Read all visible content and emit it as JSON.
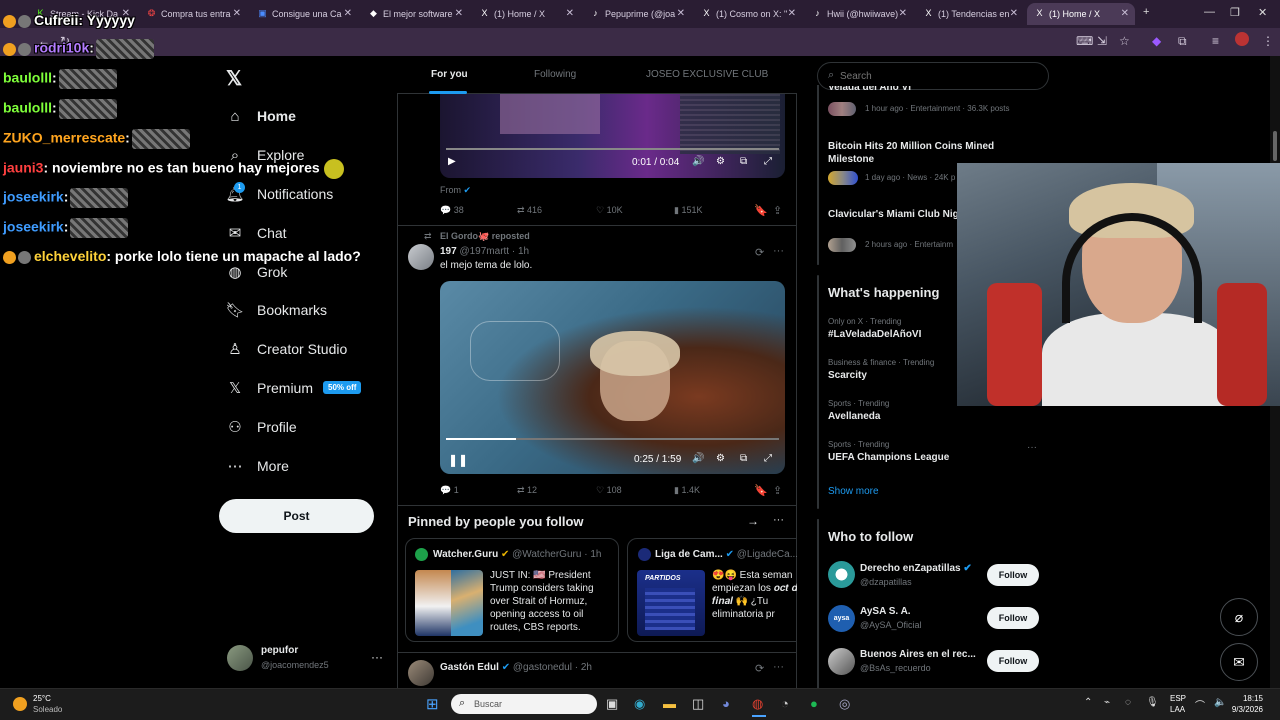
{
  "browser": {
    "tabs": [
      {
        "label": "Stream - Kick Da",
        "icon": "kick-icon"
      },
      {
        "label": "Compra tus entra",
        "icon": "ticket-icon"
      },
      {
        "label": "Consigue una Ca",
        "icon": "bluesky-icon"
      },
      {
        "label": "El mejor software",
        "icon": "diamond-icon"
      },
      {
        "label": "(1) Home / X",
        "icon": "x-icon"
      },
      {
        "label": "Pepuprime (@joa",
        "icon": "tiktok-icon"
      },
      {
        "label": "(1) Cosmo on X: \"",
        "icon": "x-icon"
      },
      {
        "label": "Hwii (@hwiiwave)",
        "icon": "tiktok-icon"
      },
      {
        "label": "(1) Tendencias en",
        "icon": "x-icon"
      },
      {
        "label": "(1) Home / X",
        "icon": "x-icon",
        "active": true
      }
    ],
    "new_tab": "+"
  },
  "chat": [
    {
      "user": "Cufreii",
      "color": "#ffffff",
      "text": ": Yyyyyy",
      "emote": false,
      "badges": true
    },
    {
      "user": "rodri10k",
      "color": "#b47cff",
      "text": ":",
      "emote": true,
      "badges": true
    },
    {
      "user": "baulolll",
      "color": "#7fff3a",
      "text": ":",
      "emote": true,
      "badges": false
    },
    {
      "user": "baulolll",
      "color": "#7fff3a",
      "text": ":",
      "emote": true,
      "badges": false
    },
    {
      "user": "ZUKO_merrescate",
      "color": "#ffa51f",
      "text": ":",
      "emote": true,
      "badges": false
    },
    {
      "user": "jauni3",
      "color": "#ff4040",
      "text": ": noviembre no es tan bueno hay mejores",
      "emote": false,
      "badges": false
    },
    {
      "user": "joseekirk",
      "color": "#3f9cff",
      "text": ":",
      "emote": true,
      "badges": false
    },
    {
      "user": "joseekirk",
      "color": "#3f9cff",
      "text": ":",
      "emote": true,
      "badges": false
    },
    {
      "user": "elchevelito",
      "color": "#ffd23a",
      "text": ": porke lolo tiene un mapache al lado?",
      "emote": false,
      "badges": true
    }
  ],
  "nav": {
    "items": [
      {
        "label": "Home",
        "icon": "home-icon"
      },
      {
        "label": "Explore",
        "icon": "search-icon"
      },
      {
        "label": "Notifications",
        "icon": "bell-icon"
      },
      {
        "label": "Chat",
        "icon": "mail-icon"
      },
      {
        "label": "Grok",
        "icon": "grok-icon"
      },
      {
        "label": "Bookmarks",
        "icon": "bookmark-icon"
      },
      {
        "label": "Creator Studio",
        "icon": "creator-icon"
      },
      {
        "label": "Premium",
        "icon": "x-icon"
      },
      {
        "label": "Profile",
        "icon": "person-icon"
      },
      {
        "label": "More",
        "icon": "more-icon"
      }
    ],
    "premium_badge": "50% off",
    "notifications_count": "1",
    "post_label": "Post",
    "account": {
      "name": "pepufor",
      "handle": "@joacomendez5"
    }
  },
  "feed": {
    "tabs": [
      "For you",
      "Following",
      "JOSEO EXCLUSIVE CLUB"
    ],
    "tweet1": {
      "video_time": "0:01 / 0:04",
      "from_label": "From",
      "replies": "38",
      "reposts": "416",
      "likes": "10K",
      "views": "151K"
    },
    "tweet2": {
      "reposted_by": "El Gordo🐙 reposted",
      "author_name": "197",
      "author_handle": "@197martt",
      "time": "1h",
      "text": "el mejo tema de lolo.",
      "video_time": "0:25 / 1:59",
      "video_progress": 0.21,
      "replies": "1",
      "reposts": "12",
      "likes": "108",
      "views": "1.4K"
    },
    "pinned": {
      "title": "Pinned by people you follow",
      "cards": [
        {
          "name": "Watcher.Guru",
          "handle": "@WatcherGuru",
          "time": "1h",
          "text": "JUST IN: 🇺🇸 President Trump considers taking over Strait of Hormuz, opening access to oil routes, CBS reports."
        },
        {
          "name": "Liga de Cam...",
          "handle": "@LigadeCa...",
          "time": "",
          "text": "😍😝 Esta seman empiezan los 𝒐𝒄𝒕 𝒅𝒆 𝒇𝒊𝒏𝒂𝒍 🙌 ¿Tu eliminatoria pr",
          "thumb_label": "PARTIDOS"
        }
      ]
    },
    "tweet3": {
      "author_name": "Gastón Edul",
      "author_handle": "@gastonedul",
      "time": "2h"
    }
  },
  "right": {
    "search_placeholder": "Search",
    "news": [
      {
        "title": "Velada del Año VI",
        "meta": "1 hour ago · Entertainment · 36.3K posts"
      },
      {
        "title": "Bitcoin Hits 20 Million Coins Mined Milestone",
        "meta": "1 day ago · News · 24K p"
      },
      {
        "title": "Clavicular's Miami Club Nig Girlfriend Drama and Deod",
        "meta": "2 hours ago · Entertainm"
      }
    ],
    "whats_happening": "What's happening",
    "trends": [
      {
        "meta": "Only on X · Trending",
        "name": "#LaVeladaDelAñoVI"
      },
      {
        "meta": "Business & finance · Trending",
        "name": "Scarcity"
      },
      {
        "meta": "Sports · Trending",
        "name": "Avellaneda"
      },
      {
        "meta": "Sports · Trending",
        "name": "UEFA Champions League"
      }
    ],
    "show_more": "Show more",
    "who_to_follow": "Who to follow",
    "follow_label": "Follow",
    "suggestions": [
      {
        "name": "Derecho enZapatillas",
        "handle": "@dzapatillas",
        "verified": true
      },
      {
        "name": "AySA S. A.",
        "handle": "@AySA_Oficial",
        "verified": false
      },
      {
        "name": "Buenos Aires en el rec...",
        "handle": "@BsAs_recuerdo",
        "verified": false
      }
    ]
  },
  "taskbar": {
    "weather_temp": "25°C",
    "weather_desc": "Soleado",
    "search_placeholder": "Buscar",
    "lang": "ESP",
    "lang2": "LAA",
    "time": "18:15",
    "date": "9/3/2026"
  }
}
